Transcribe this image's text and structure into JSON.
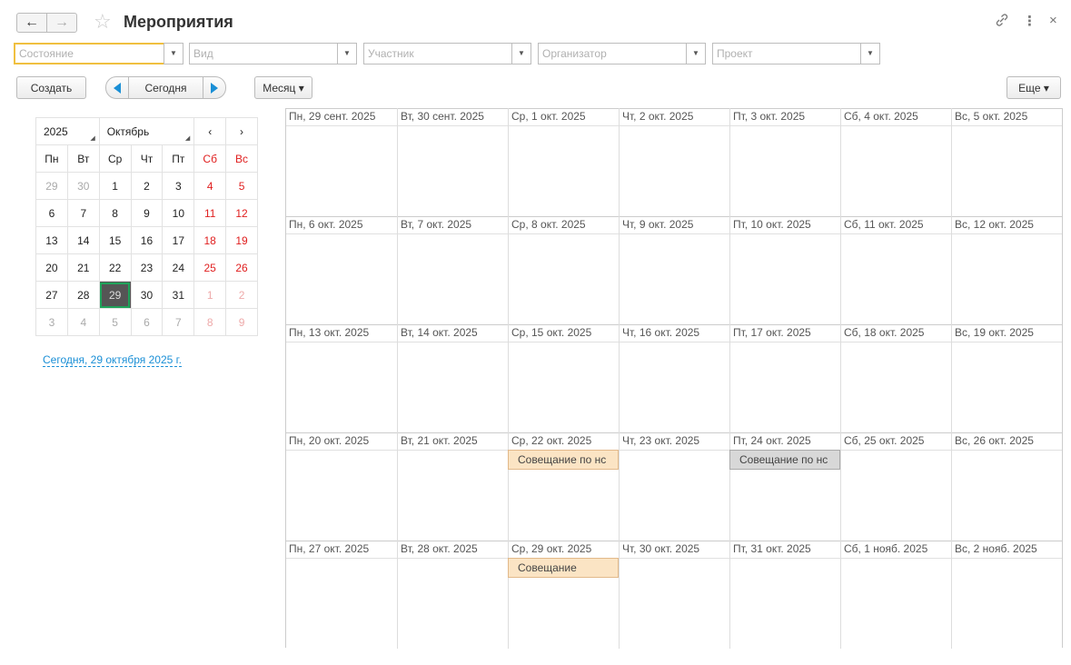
{
  "header": {
    "title": "Мероприятия",
    "back_icon": "←",
    "forward_icon": "→",
    "star_icon": "☆",
    "link_icon": "🔗",
    "more_icon": "⋮",
    "close_icon": "×"
  },
  "filters": [
    {
      "placeholder": "Состояние"
    },
    {
      "placeholder": "Вид"
    },
    {
      "placeholder": "Участник"
    },
    {
      "placeholder": "Организатор"
    },
    {
      "placeholder": "Проект"
    }
  ],
  "toolbar": {
    "create_label": "Создать",
    "today_label": "Сегодня",
    "period_label": "Месяц ▾",
    "more_label": "Еще ▾"
  },
  "mini_calendar": {
    "year": "2025",
    "month": "Октябрь",
    "prev": "‹",
    "next": "›",
    "weekdays": [
      "Пн",
      "Вт",
      "Ср",
      "Чт",
      "Пт",
      "Сб",
      "Вс"
    ],
    "weeks": [
      [
        "29",
        "30",
        "1",
        "2",
        "3",
        "4",
        "5"
      ],
      [
        "6",
        "7",
        "8",
        "9",
        "10",
        "11",
        "12"
      ],
      [
        "13",
        "14",
        "15",
        "16",
        "17",
        "18",
        "19"
      ],
      [
        "20",
        "21",
        "22",
        "23",
        "24",
        "25",
        "26"
      ],
      [
        "27",
        "28",
        "29",
        "30",
        "31",
        "1",
        "2"
      ],
      [
        "3",
        "4",
        "5",
        "6",
        "7",
        "8",
        "9"
      ]
    ],
    "selected": "29",
    "today_link": "Сегодня, 29 октября 2025 г."
  },
  "calendar": {
    "weeks": [
      [
        "Пн, 29 сент. 2025",
        "Вт, 30 сент. 2025",
        "Ср, 1 окт. 2025",
        "Чт, 2 окт. 2025",
        "Пт, 3 окт. 2025",
        "Сб, 4 окт. 2025",
        "Вс, 5 окт. 2025"
      ],
      [
        "Пн, 6 окт. 2025",
        "Вт, 7 окт. 2025",
        "Ср, 8 окт. 2025",
        "Чт, 9 окт. 2025",
        "Пт, 10 окт. 2025",
        "Сб, 11 окт. 2025",
        "Вс, 12 окт. 2025"
      ],
      [
        "Пн, 13 окт. 2025",
        "Вт, 14 окт. 2025",
        "Ср, 15 окт. 2025",
        "Чт, 16 окт. 2025",
        "Пт, 17 окт. 2025",
        "Сб, 18 окт. 2025",
        "Вс, 19 окт. 2025"
      ],
      [
        "Пн, 20 окт. 2025",
        "Вт, 21 окт. 2025",
        "Ср, 22 окт. 2025",
        "Чт, 23 окт. 2025",
        "Пт, 24 окт. 2025",
        "Сб, 25 окт. 2025",
        "Вс, 26 окт. 2025"
      ],
      [
        "Пн, 27 окт. 2025",
        "Вт, 28 окт. 2025",
        "Ср, 29 окт. 2025",
        "Чт, 30 окт. 2025",
        "Пт, 31 окт. 2025",
        "Сб, 1 нояб. 2025",
        "Вс, 2 нояб. 2025"
      ]
    ],
    "events": [
      {
        "week": 3,
        "day": 2,
        "title": "Совещание по нс",
        "style": "orange"
      },
      {
        "week": 3,
        "day": 4,
        "title": "Совещание по нс",
        "style": "gray"
      },
      {
        "week": 4,
        "day": 2,
        "title": "Совещание",
        "style": "orange"
      }
    ]
  }
}
